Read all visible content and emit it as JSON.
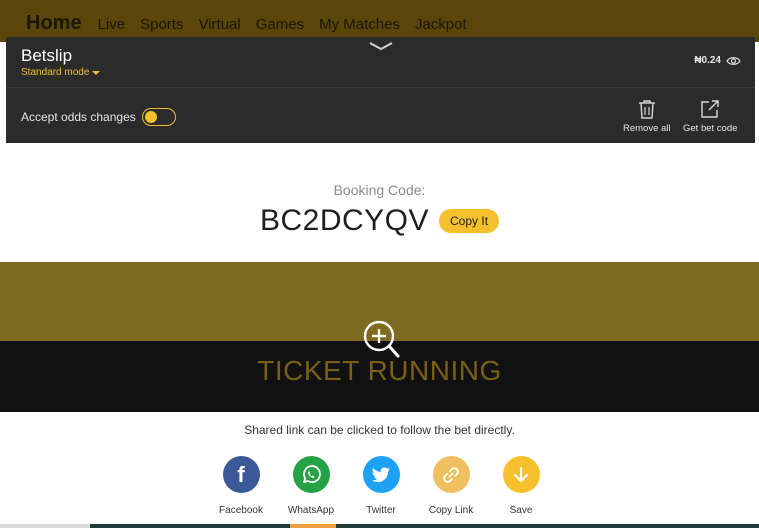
{
  "nav": {
    "home": "Home",
    "items": [
      "Live",
      "Sports",
      "Virtual",
      "Games",
      "My Matches",
      "Jackpot"
    ]
  },
  "betslip": {
    "title": "Betslip",
    "mode": "Standard mode",
    "balance": "₦0.24",
    "accept_label": "Accept odds changes",
    "accept_enabled": false,
    "remove_label": "Remove all",
    "getcode_label": "Get bet code"
  },
  "booking": {
    "label": "Booking Code:",
    "code": "BC2DCYQV",
    "copy_label": "Copy It"
  },
  "ticket": {
    "status": "TICKET RUNNING"
  },
  "share": {
    "message": "Shared link can be clicked to follow the bet directly.",
    "options": [
      {
        "label": "Facebook",
        "icon": "facebook-icon",
        "color": "#3b5998"
      },
      {
        "label": "WhatsApp",
        "icon": "whatsapp-icon",
        "color": "#25a244"
      },
      {
        "label": "Twitter",
        "icon": "twitter-icon",
        "color": "#1da1f2"
      },
      {
        "label": "Copy Link",
        "icon": "link-icon",
        "color": "#f0c060"
      },
      {
        "label": "Save",
        "icon": "download-icon",
        "color": "#f5c02b"
      }
    ]
  },
  "colors": {
    "accent": "#f5c02b",
    "panel": "#2b2b2b",
    "banner_top": "#7e6a20",
    "banner_bottom": "#111111"
  }
}
